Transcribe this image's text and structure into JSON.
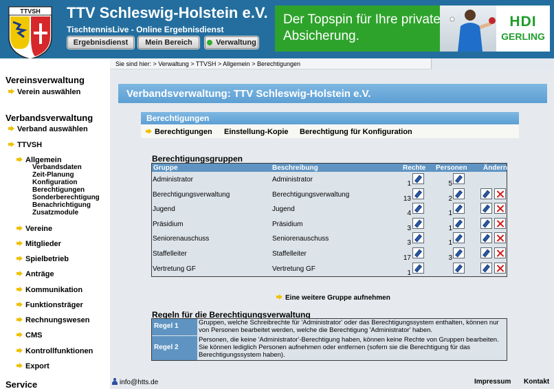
{
  "header": {
    "title": "TTV Schleswig-Holstein e.V.",
    "subtitle": "TischtennisLive - Online Ergebnisdienst",
    "logo_text": "TTVSH",
    "buttons": [
      "Ergebnisdienst",
      "Mein Bereich",
      "Verwaltung"
    ],
    "banner_text": "Der Topspin für Ihre private Absicherung.",
    "banner_brand_1": "HDI",
    "banner_brand_2": "GERLING",
    "colors": {
      "header_bg": "#236e9e",
      "banner_bg": "#2ea32b"
    }
  },
  "sidebar": {
    "vereinsverwaltung": "Vereinsverwaltung",
    "verein_auswaehlen": "Verein auswählen",
    "verbandsverwaltung": "Verbandsverwaltung",
    "verband_auswaehlen": "Verband auswählen",
    "ttvsh": "TTVSH",
    "allgemein": "Allgemein",
    "allgemein_sub": [
      "Verbandsdaten",
      "Zeit-Planung",
      "Konfiguration",
      "Berechtigungen",
      "Sonderberechtigung",
      "Benachrichtigung",
      "Zusatzmodule"
    ],
    "items": [
      "Vereine",
      "Mitglieder",
      "Spielbetrieb",
      "Anträge",
      "Kommunikation",
      "Funktionsträger",
      "Rechnungswesen",
      "CMS",
      "Kontrollfunktionen",
      "Export"
    ],
    "service": "Service"
  },
  "breadcrumb": "Sie sind hier: > Verwaltung > TTVSH > Allgemein > Berechtigungen",
  "page_title": "Verbandsverwaltung: TTV Schleswig-Holstein e.V.",
  "section": {
    "title": "Berechtigungen",
    "subnav": [
      "Berechtigungen",
      "Einstellung-Kopie",
      "Berechtigung für Konfiguration"
    ]
  },
  "groups": {
    "title": "Berechtigungsgruppen",
    "columns": [
      "Gruppe",
      "Beschreibung",
      "Rechte",
      "Personen",
      "Ändern"
    ],
    "rows": [
      {
        "name": "Administrator",
        "desc": "Administrator",
        "rechte": "1",
        "personen": "5",
        "editable": false
      },
      {
        "name": "Berechtigungsverwaltung",
        "desc": "Berechtigungsverwaltung",
        "rechte": "13",
        "personen": "2",
        "editable": true
      },
      {
        "name": "Jugend",
        "desc": "Jugend",
        "rechte": "4",
        "personen": "1",
        "editable": true
      },
      {
        "name": "Präsidium",
        "desc": "Präsidium",
        "rechte": "3",
        "personen": "1",
        "editable": true
      },
      {
        "name": "Seniorenauschuss",
        "desc": "Seniorenauschuss",
        "rechte": "3",
        "personen": "1",
        "editable": true
      },
      {
        "name": "Staffelleiter",
        "desc": "Staffelleiter",
        "rechte": "17",
        "personen": "3",
        "editable": true
      },
      {
        "name": "Vertretung GF",
        "desc": "Vertretung GF",
        "rechte": "1",
        "personen": "",
        "editable": true
      }
    ],
    "add_link": "Eine weitere Gruppe aufnehmen"
  },
  "rules": {
    "title": "Regeln für die Berechtigungsverwaltung",
    "items": [
      {
        "label": "Regel 1",
        "text": "Gruppen, welche Schreibrechte für 'Administrator' oder das Berechtigungssystem enthalten, können nur von Personen bearbeitet werden, welche die Berechtigung 'Administrator' haben."
      },
      {
        "label": "Regel 2",
        "text": "Personen, die keine 'Administrator'-Berechtigung haben, können keine Rechte von Gruppen bearbeiten. Sie können lediglich Personen aufnehmen oder entfernen (sofern sie die Berechtigung für das Berechtigungssystem haben)."
      }
    ]
  },
  "footer": {
    "email": "info@htts.de",
    "impressum": "Impressum",
    "kontakt": "Kontakt"
  }
}
